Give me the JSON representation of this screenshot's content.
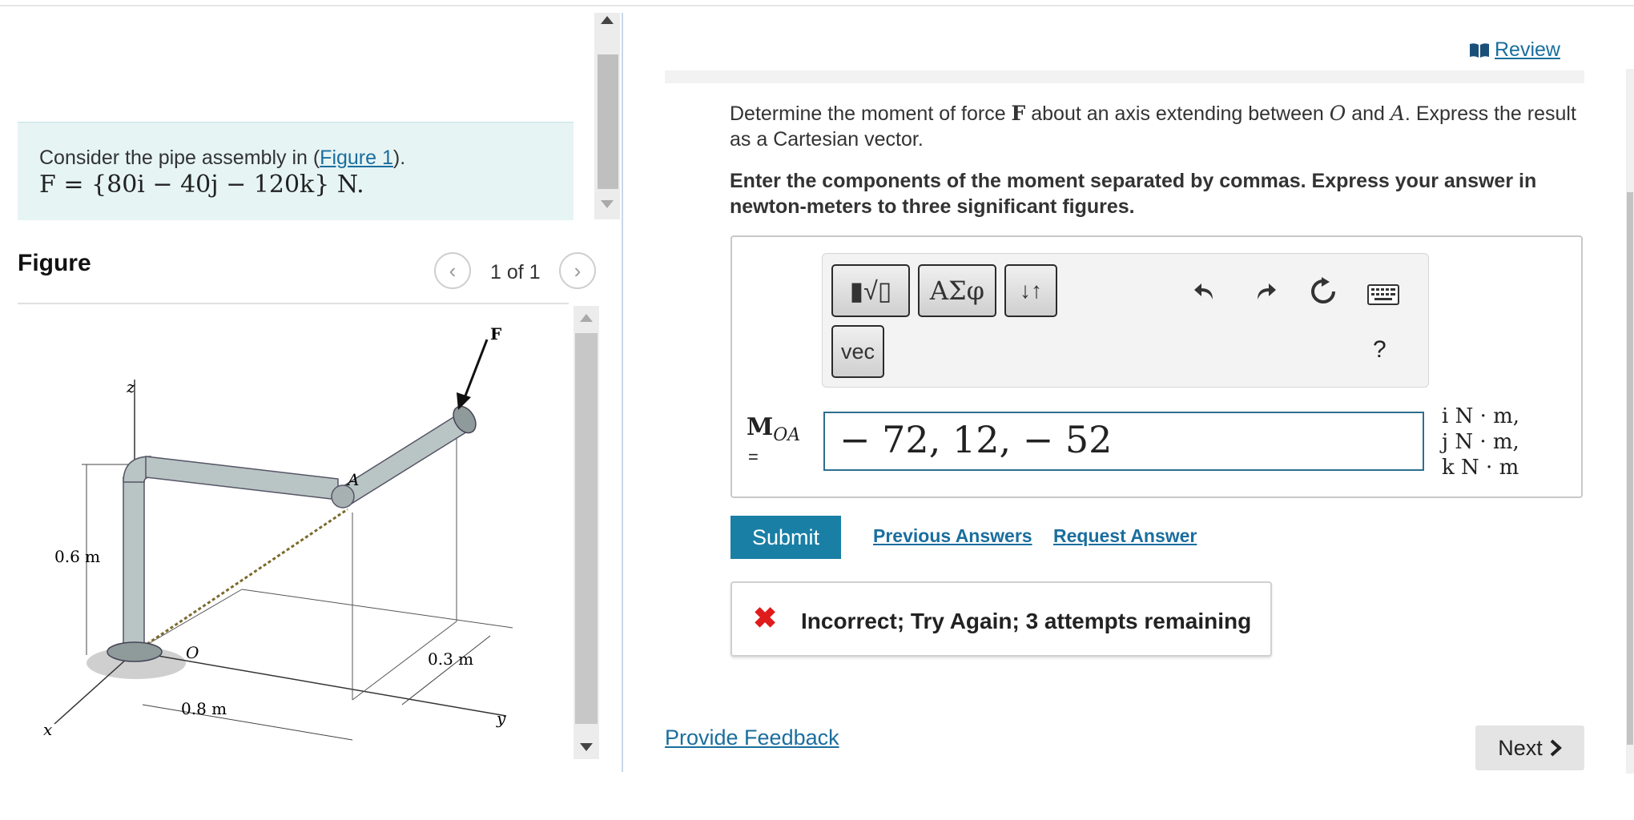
{
  "problem": {
    "intro": "Consider the pipe assembly in (",
    "figure_link": "Figure 1",
    "intro_end": ").",
    "force_eq": "F = {80i − 40j − 120k} N."
  },
  "figure": {
    "title": "Figure",
    "counter": "1 of 1",
    "labels": {
      "F": "F",
      "z": "z",
      "A": "A",
      "O": "O",
      "x": "x",
      "y": "y",
      "d1": "0.6 m",
      "d2": "0.3 m",
      "d3": "0.8 m"
    }
  },
  "header": {
    "review_label": "Review"
  },
  "question": {
    "text_pre": "Determine the moment of force ",
    "force": "F",
    "text_mid": " about an axis extending between ",
    "point_o": "O",
    "text_and": " and ",
    "point_a": "A",
    "text_post": ". Express the result as a Cartesian vector.",
    "instructions": "Enter the components of the moment separated by commas. Express your answer in newton-meters to three significant figures."
  },
  "toolbar": {
    "templates_label": "▮√▯",
    "greek_label": "ΑΣφ",
    "arrows_label": "↓↑",
    "vec_label": "vec",
    "help_label": "?"
  },
  "answer": {
    "label_main": "M",
    "label_sub": "OA",
    "label_eq": "=",
    "value": "− 72, 12, − 52",
    "units": [
      "i N · m,",
      "j N · m,",
      "k N · m"
    ]
  },
  "actions": {
    "submit": "Submit",
    "previous_answers": "Previous Answers",
    "request_answer": "Request Answer"
  },
  "feedback": {
    "icon": "✖",
    "message": "Incorrect; Try Again; 3 attempts remaining"
  },
  "footer": {
    "provide_feedback": "Provide Feedback",
    "next": "Next"
  },
  "colors": {
    "link": "#1a6e9e",
    "submit_bg": "#1a7fa5",
    "error": "#e01b1b",
    "problem_bg": "#e6f4f4"
  }
}
